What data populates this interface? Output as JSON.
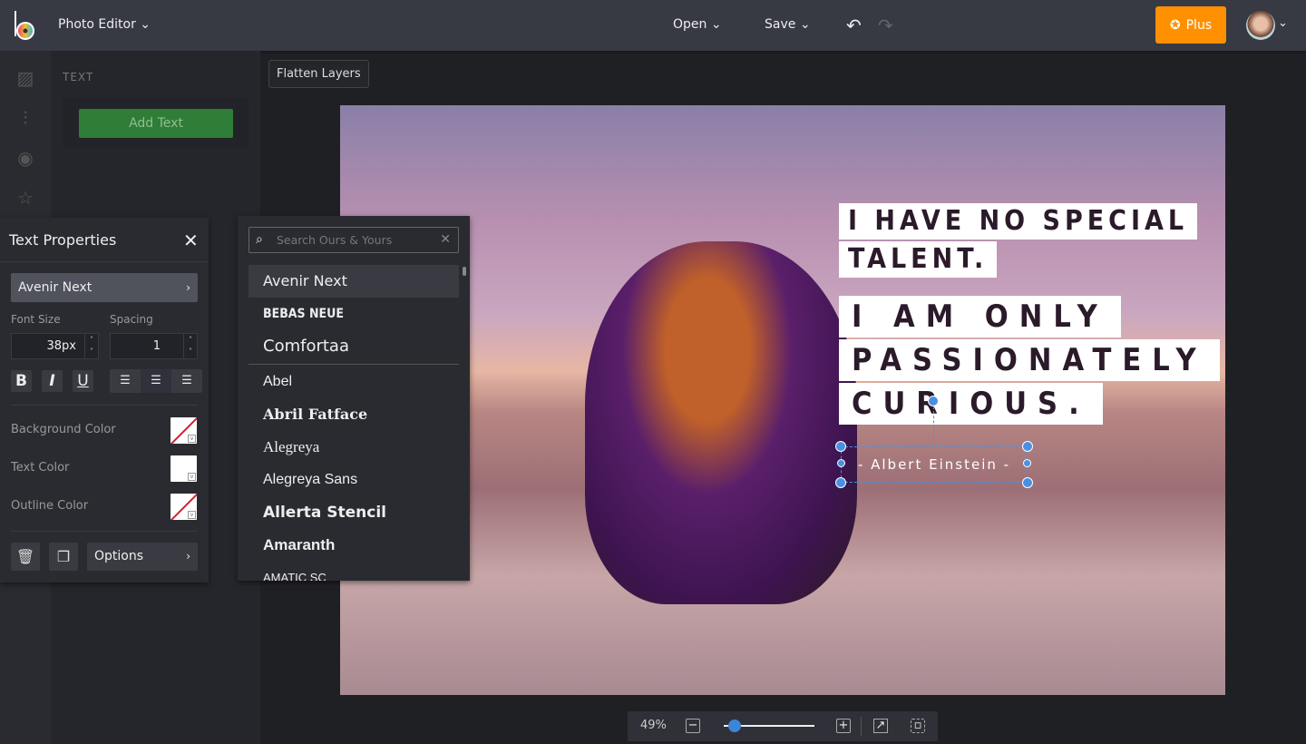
{
  "topbar": {
    "app_title": "Photo Editor",
    "open": "Open",
    "save": "Save",
    "plus": "Plus",
    "accent": "#ff9000"
  },
  "left_panel": {
    "heading": "TEXT",
    "add_text": "Add Text"
  },
  "canvas": {
    "flatten": "Flatten Layers",
    "quote": [
      "I HAVE NO SPECIAL",
      "TALENT.",
      "I AM ONLY",
      "PASSIONATELY",
      "CURIOUS."
    ],
    "author": "- Albert Einstein -"
  },
  "text_properties": {
    "title": "Text Properties",
    "font": "Avenir Next",
    "font_size_label": "Font Size",
    "font_size": "38",
    "font_size_unit": "px",
    "spacing_label": "Spacing",
    "spacing": "1",
    "bold": "B",
    "italic": "I",
    "underline": "U",
    "background_color_label": "Background Color",
    "text_color_label": "Text Color",
    "outline_color_label": "Outline Color",
    "options": "Options",
    "text_color": "#ffffff"
  },
  "font_picker": {
    "search_placeholder": "Search Ours & Yours",
    "featured": [
      "Avenir Next",
      "BEBAS NEUE",
      "Comfortaa"
    ],
    "fonts": [
      "Abel",
      "Abril Fatface",
      "Alegreya",
      "Alegreya Sans",
      "Allerta Stencil",
      "Amaranth",
      "AMATIC SC"
    ]
  },
  "zoom": {
    "level": "49%",
    "slider_fraction": 0.12
  }
}
